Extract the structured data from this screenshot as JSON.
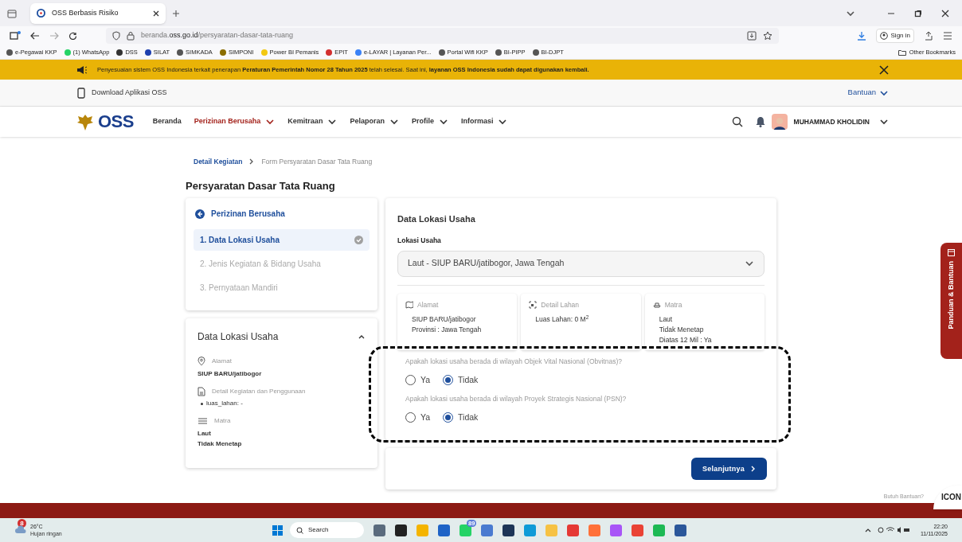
{
  "browser": {
    "tab_title": "OSS Berbasis Risiko",
    "url_prefix": "beranda.",
    "url_domain": "oss.go.id",
    "url_path": "/persyaratan-dasar-tata-ruang",
    "sign_in": "Sign in",
    "bookmarks": [
      {
        "label": "e-Pegawai KKP",
        "color": "#555555"
      },
      {
        "label": "(1) WhatsApp",
        "color": "#25d366"
      },
      {
        "label": "DSS",
        "color": "#333333"
      },
      {
        "label": "SILAT",
        "color": "#1e40af"
      },
      {
        "label": "SIMKADA",
        "color": "#555555"
      },
      {
        "label": "SIMPONI",
        "color": "#8a6d00"
      },
      {
        "label": "Power BI Pemanis",
        "color": "#f2c811"
      },
      {
        "label": "EPIT",
        "color": "#d33030"
      },
      {
        "label": "e-LAYAR | Layanan Per...",
        "color": "#3b82f6"
      },
      {
        "label": "Portal Wifi KKP",
        "color": "#555555"
      },
      {
        "label": "BI-PIPP",
        "color": "#555555"
      },
      {
        "label": "BI-DJPT",
        "color": "#555555"
      }
    ],
    "other_bookmarks": "Other Bookmarks"
  },
  "banner": {
    "text": "Penyesuaian sistem OSS Indonesia terkait penerapan **Peraturan Pemerintah Nomor 28 Tahun 2025** telah selesai. Saat ini, **layanan OSS Indonesia sudah dapat digunakan kembali.**"
  },
  "topbar": {
    "download": "Download Aplikasi OSS",
    "help": "Bantuan"
  },
  "nav": {
    "logo": "OSS",
    "items": [
      {
        "label": "Beranda",
        "selected": false,
        "dropdown": false
      },
      {
        "label": "Perizinan Berusaha",
        "selected": true,
        "dropdown": true
      },
      {
        "label": "Kemitraan",
        "selected": false,
        "dropdown": true
      },
      {
        "label": "Pelaporan",
        "selected": false,
        "dropdown": true
      },
      {
        "label": "Profile",
        "selected": false,
        "dropdown": true
      },
      {
        "label": "Informasi",
        "selected": false,
        "dropdown": true
      }
    ],
    "user": "MUHAMMAD KHOLIDIN"
  },
  "breadcrumb": [
    "Detail Kegiatan",
    "Form Persyaratan Dasar Tata Ruang"
  ],
  "page_title": "Persyaratan Dasar Tata Ruang",
  "sidebar": {
    "back": "Perizinan Berusaha",
    "steps": [
      {
        "label": "1. Data Lokasi Usaha",
        "selected": true,
        "done": true
      },
      {
        "label": "2. Jenis Kegiatan & Bidang Usaha",
        "selected": false,
        "done": false
      },
      {
        "label": "3. Pernyataan Mandiri",
        "selected": false,
        "done": false
      }
    ]
  },
  "summary": {
    "title": "Data Lokasi Usaha",
    "expanded": true,
    "sections": [
      {
        "kind": "location",
        "label": "Alamat",
        "values": [
          "SIUP BARU/jatibogor"
        ]
      },
      {
        "kind": "document",
        "label": "Detail Kegiatan dan Penggunaan",
        "bullets": [
          "luas_lahan: -"
        ]
      },
      {
        "kind": "layers",
        "label": "Matra",
        "values": [
          "Laut",
          "Tidak Menetap"
        ]
      }
    ]
  },
  "main": {
    "title": "Data Lokasi Usaha",
    "field_label": "Lokasi Usaha",
    "select_value": "Laut - SIUP BARU/jatibogor, Jawa Tengah",
    "info_cards": [
      {
        "kind": "map",
        "label": "Alamat",
        "lines": [
          "SIUP BARU/jatibogor",
          "Provinsi : Jawa Tengah"
        ]
      },
      {
        "kind": "area",
        "label": "Detail Lahan",
        "lines": [
          "Luas Lahan: 0 M$^{2}$"
        ]
      },
      {
        "kind": "ship",
        "label": "Matra",
        "lines": [
          "Laut",
          "Tidak Menetap",
          "Diatas 12 Mil : Ya"
        ]
      }
    ],
    "questions": [
      {
        "text": "Apakah lokasi usaha berada di wilayah Objek Vital Nasional (Obvitnas)?",
        "options": [
          {
            "label": "Ya",
            "selected": false
          },
          {
            "label": "Tidak",
            "selected": true
          }
        ]
      },
      {
        "text": "Apakah lokasi usaha berada di wilayah Proyek Strategis Nasional (PSN)?",
        "options": [
          {
            "label": "Ya",
            "selected": false
          },
          {
            "label": "Tidak",
            "selected": true
          }
        ]
      }
    ],
    "next": "Selanjutnya"
  },
  "side_tab": "Panduan & Bantuan",
  "help_widget": {
    "hint": "Butuh Bantuan?",
    "label": "ICON"
  },
  "taskbar": {
    "weather_badge": "8",
    "temperature": "26°C",
    "weather": "Hujan ringan",
    "search": "Search",
    "apps": [
      {
        "color": "#5a6b7d"
      },
      {
        "color": "#222222"
      },
      {
        "color": "#f4b400"
      },
      {
        "color": "#1e63c6"
      },
      {
        "color": "#25d366",
        "badge": "89"
      },
      {
        "color": "#4a7bd0"
      },
      {
        "color": "#1d3557"
      },
      {
        "color": "#0f9bd7"
      },
      {
        "color": "#f6c244"
      },
      {
        "color": "#e53935"
      },
      {
        "color": "#ff7139"
      },
      {
        "color": "#a855f7"
      },
      {
        "color": "#ea4335"
      },
      {
        "color": "#1db954"
      },
      {
        "color": "#2b579a"
      }
    ],
    "time": "22:20",
    "date": "11/11/2025"
  }
}
